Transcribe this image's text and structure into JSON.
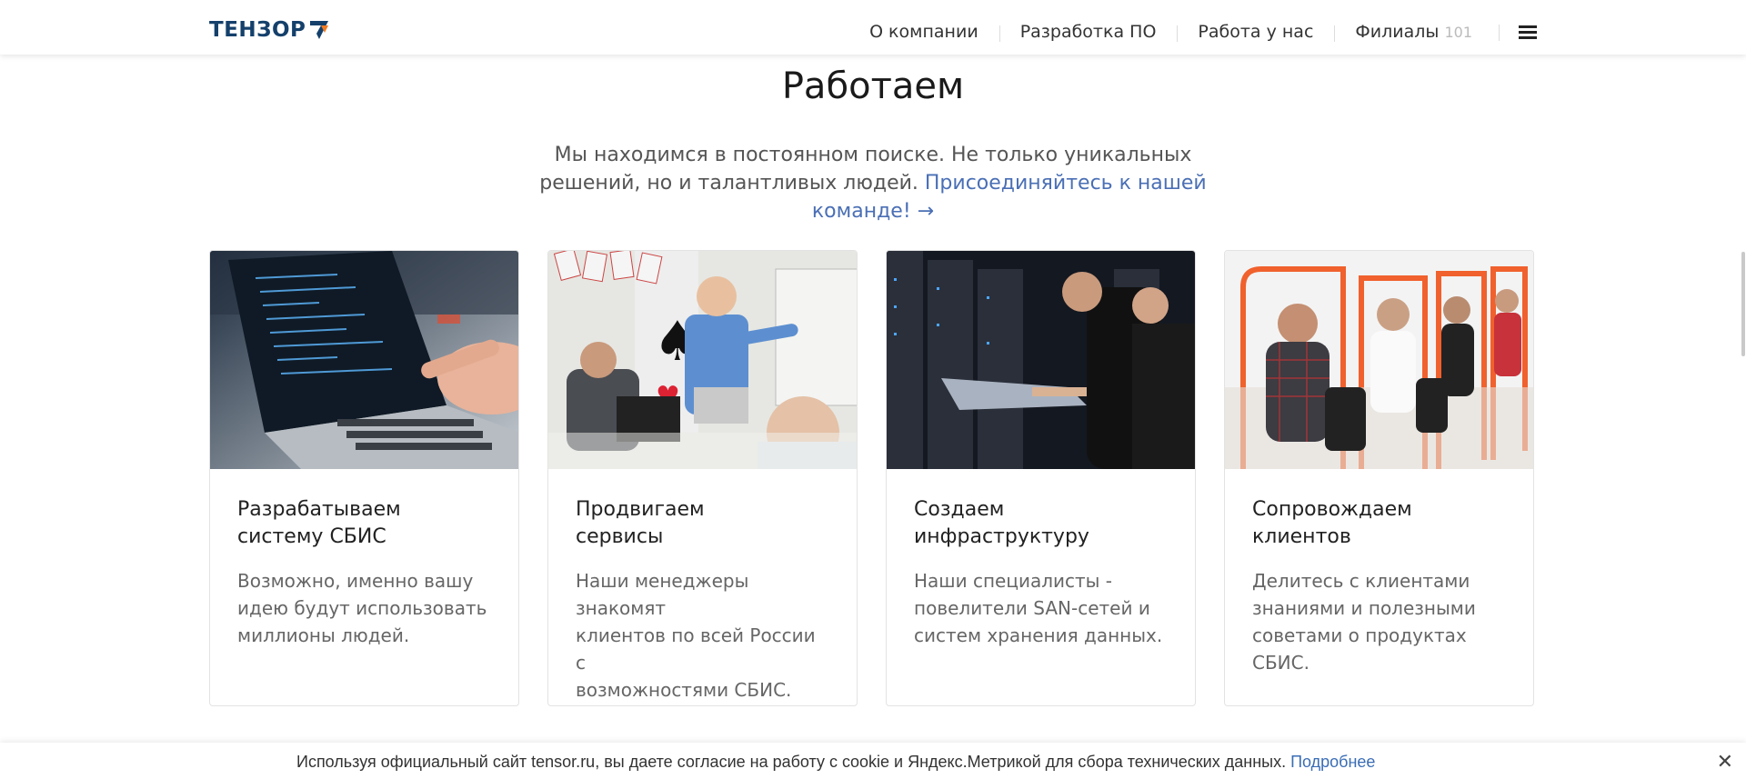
{
  "header": {
    "logo_text": "ТЕНЗОР",
    "nav": [
      {
        "label": "О компании"
      },
      {
        "label": "Разработка ПО"
      },
      {
        "label": "Работа у нас"
      },
      {
        "label": "Филиалы",
        "count": "101"
      }
    ]
  },
  "hero": {
    "title": "Работаем",
    "lead_text": "Мы находимся в постоянном поиске. Не только уникальных решений, но и талантливых людей. ",
    "lead_link": "Присоединяйтесь к нашей команде! →"
  },
  "cards": [
    {
      "title": "Разрабатываем\nсистему СБИС",
      "text": "Возможно, именно вашу\nидею будут использовать\nмиллионы людей.",
      "image_icon": "laptop-coding-photo"
    },
    {
      "title": "Продвигаем\nсервисы",
      "text": "Наши менеджеры знакомят\nклиентов по всей России с\nвозможностями СБИС.",
      "image_icon": "presentation-photo"
    },
    {
      "title": "Создаем\nинфраструктуру",
      "text": "Наши специалисты -\nповелители SAN-сетей и\nсистем  хранения  данных.",
      "image_icon": "server-room-photo"
    },
    {
      "title": "Сопровождаем\nклиентов",
      "text": "Делитесь с клиентами\nзнаниями и полезными\nсоветами о продуктах\nСБИС.",
      "image_icon": "call-center-photo"
    }
  ],
  "cookie": {
    "text": "Используя официальный сайт tensor.ru, вы даете согласие на работу с cookie и Яндекс.Метрикой для сбора технических данных. ",
    "link": "Подробнее",
    "close_icon": "close-icon"
  },
  "colors": {
    "brand": "#14406b",
    "brand_accent": "#f07a22",
    "link": "#4a6fb5"
  }
}
